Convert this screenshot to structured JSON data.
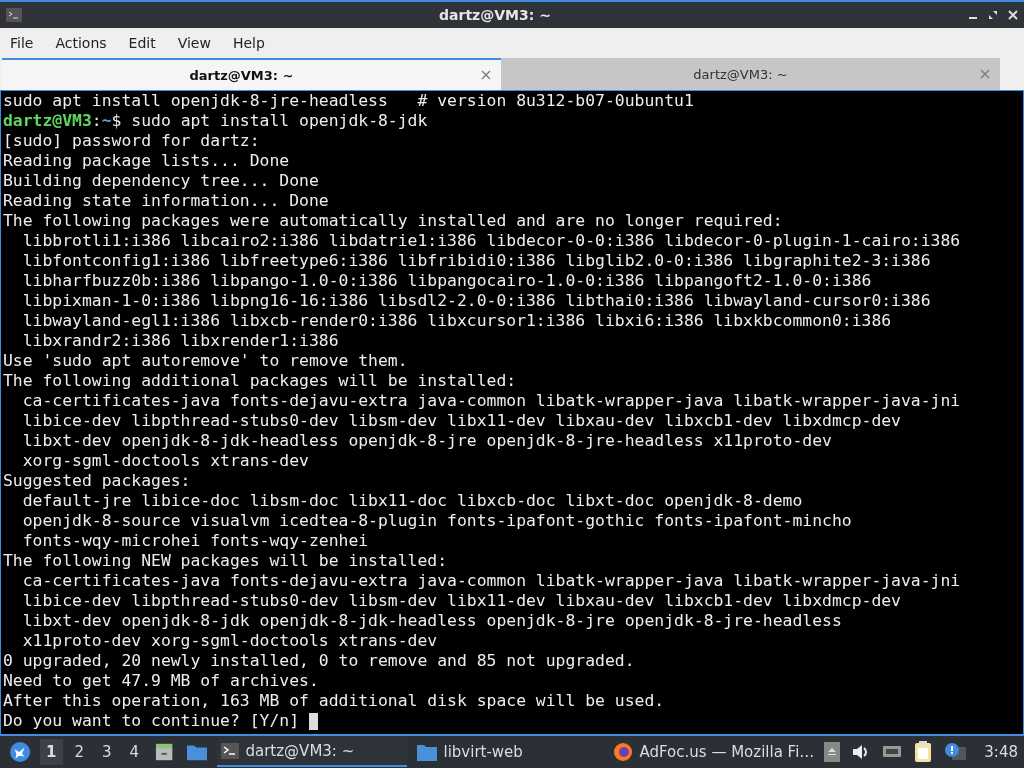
{
  "window": {
    "title": "dartz@VM3: ~"
  },
  "menu": [
    "File",
    "Actions",
    "Edit",
    "View",
    "Help"
  ],
  "tabs": [
    {
      "label": "dartz@VM3: ~",
      "selected": true
    },
    {
      "label": "dartz@VM3: ~",
      "selected": false
    }
  ],
  "terminal": {
    "lines": [
      {
        "kind": "text",
        "text": "sudo apt install openjdk-8-jre-headless   # version 8u312-b07-0ubuntu1"
      },
      {
        "kind": "prompt",
        "user": "dartz@VM3",
        "separator": ":",
        "path": "~",
        "command": "$ sudo apt install openjdk-8-jdk"
      },
      {
        "kind": "text",
        "text": "[sudo] password for dartz:"
      },
      {
        "kind": "text",
        "text": "Reading package lists... Done"
      },
      {
        "kind": "text",
        "text": "Building dependency tree... Done"
      },
      {
        "kind": "text",
        "text": "Reading state information... Done"
      },
      {
        "kind": "text",
        "text": "The following packages were automatically installed and are no longer required:"
      },
      {
        "kind": "text",
        "text": "  libbrotli1:i386 libcairo2:i386 libdatrie1:i386 libdecor-0-0:i386 libdecor-0-plugin-1-cairo:i386"
      },
      {
        "kind": "text",
        "text": "  libfontconfig1:i386 libfreetype6:i386 libfribidi0:i386 libglib2.0-0:i386 libgraphite2-3:i386"
      },
      {
        "kind": "text",
        "text": "  libharfbuzz0b:i386 libpango-1.0-0:i386 libpangocairo-1.0-0:i386 libpangoft2-1.0-0:i386"
      },
      {
        "kind": "text",
        "text": "  libpixman-1-0:i386 libpng16-16:i386 libsdl2-2.0-0:i386 libthai0:i386 libwayland-cursor0:i386"
      },
      {
        "kind": "text",
        "text": "  libwayland-egl1:i386 libxcb-render0:i386 libxcursor1:i386 libxi6:i386 libxkbcommon0:i386"
      },
      {
        "kind": "text",
        "text": "  libxrandr2:i386 libxrender1:i386"
      },
      {
        "kind": "text",
        "text": "Use 'sudo apt autoremove' to remove them."
      },
      {
        "kind": "text",
        "text": "The following additional packages will be installed:"
      },
      {
        "kind": "text",
        "text": "  ca-certificates-java fonts-dejavu-extra java-common libatk-wrapper-java libatk-wrapper-java-jni"
      },
      {
        "kind": "text",
        "text": "  libice-dev libpthread-stubs0-dev libsm-dev libx11-dev libxau-dev libxcb1-dev libxdmcp-dev"
      },
      {
        "kind": "text",
        "text": "  libxt-dev openjdk-8-jdk-headless openjdk-8-jre openjdk-8-jre-headless x11proto-dev"
      },
      {
        "kind": "text",
        "text": "  xorg-sgml-doctools xtrans-dev"
      },
      {
        "kind": "text",
        "text": "Suggested packages:"
      },
      {
        "kind": "text",
        "text": "  default-jre libice-doc libsm-doc libx11-doc libxcb-doc libxt-doc openjdk-8-demo"
      },
      {
        "kind": "text",
        "text": "  openjdk-8-source visualvm icedtea-8-plugin fonts-ipafont-gothic fonts-ipafont-mincho"
      },
      {
        "kind": "text",
        "text": "  fonts-wqy-microhei fonts-wqy-zenhei"
      },
      {
        "kind": "text",
        "text": "The following NEW packages will be installed:"
      },
      {
        "kind": "text",
        "text": "  ca-certificates-java fonts-dejavu-extra java-common libatk-wrapper-java libatk-wrapper-java-jni"
      },
      {
        "kind": "text",
        "text": "  libice-dev libpthread-stubs0-dev libsm-dev libx11-dev libxau-dev libxcb1-dev libxdmcp-dev"
      },
      {
        "kind": "text",
        "text": "  libxt-dev openjdk-8-jdk openjdk-8-jdk-headless openjdk-8-jre openjdk-8-jre-headless"
      },
      {
        "kind": "text",
        "text": "  x11proto-dev xorg-sgml-doctools xtrans-dev"
      },
      {
        "kind": "text",
        "text": "0 upgraded, 20 newly installed, 0 to remove and 85 not upgraded."
      },
      {
        "kind": "text",
        "text": "Need to get 47.9 MB of archives."
      },
      {
        "kind": "text",
        "text": "After this operation, 163 MB of additional disk space will be used."
      },
      {
        "kind": "input",
        "text": "Do you want to continue? [Y/n] "
      }
    ]
  },
  "taskbar": {
    "workspaces": [
      {
        "label": "1",
        "selected": true
      },
      {
        "label": "2",
        "selected": false
      },
      {
        "label": "3",
        "selected": false
      },
      {
        "label": "4",
        "selected": false
      }
    ],
    "tasks": [
      {
        "kind": "terminal",
        "label": "dartz@VM3: ~",
        "selected": true
      },
      {
        "kind": "folder",
        "label": "libvirt-web",
        "selected": false
      },
      {
        "kind": "browser",
        "label": "AdFoc.us — Mozilla Fi…",
        "selected": false
      }
    ],
    "clock": "3:48"
  }
}
